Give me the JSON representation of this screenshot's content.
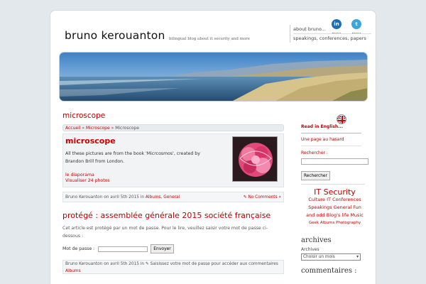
{
  "header": {
    "site_title": "bruno kerouanton",
    "tagline": "bilingual blog about it security and more",
    "nav": [
      "about bruno...",
      "speakings, conferences, papers"
    ],
    "icons": [
      "linkedin-icon",
      "twitter-icon"
    ]
  },
  "main": {
    "section_title": "microscope",
    "breadcrumb": {
      "home": "Accueil",
      "sep": " » ",
      "parent": "Microscope",
      "current": "Microscope"
    },
    "album": {
      "title": "microscope",
      "description": "All these pictures are from the book 'Micrcosmos', created by Brandon Brill from London.",
      "slideshow_link": "le diaporama",
      "photos_link": "Visualiser 24 photos"
    },
    "meta1": {
      "prefix": "Bruno Kerouanton on avril 5th 2015 in ",
      "cat1": "Albums",
      "sep": ", ",
      "cat2": "General",
      "comments": "No Comments »"
    },
    "post2": {
      "title": "protégé : assemblée générale 2015 société française",
      "protected_text": "Cet article est protégé par un mot de passe. Pour le lire, veuillez saisir votre mot de passe ci-dessous :",
      "password_label": "Mot de passe :",
      "submit_label": "Envoyer"
    },
    "meta2": {
      "prefix": "Bruno Kerouanton on avril 5th 2015 in ",
      "cat1": "Albums",
      "comments": "Saisissez votre mot de passe pour accéder aux commentaires"
    }
  },
  "sidebar": {
    "read_english": "Read in English...",
    "random_page": "Une page au hasard",
    "search_label": "Rechercher :",
    "search_button": "Rechercher",
    "tag_cloud": {
      "line1": "IT Security",
      "line2": "Culture IT Conferences",
      "line3": "Speakings General Fun",
      "line4": "and odd Blog's life Music",
      "line5": "Geek Albums Photography"
    },
    "archives_title": "archives",
    "archives_label": "Archives",
    "archives_select": "Choisir un mois",
    "comments_title": "commentaires :"
  },
  "colors": {
    "accent": "#bb0000",
    "background": "#e3e8ec"
  }
}
